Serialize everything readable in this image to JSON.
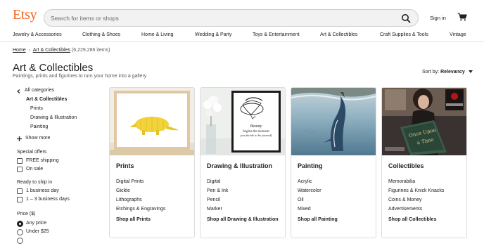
{
  "header": {
    "logo": "Etsy",
    "search_placeholder": "Search for items or shops",
    "signin": "Sign in"
  },
  "nav": [
    "Jewelry & Accessories",
    "Clothing & Shoes",
    "Home & Living",
    "Wedding & Party",
    "Toys & Entertainment",
    "Art & Collectibles",
    "Craft Supplies & Tools",
    "Vintage"
  ],
  "breadcrumb": {
    "home": "Home",
    "current": "Art & Collectibles",
    "count": "(6,229,286 items)"
  },
  "page": {
    "title": "Art & Collectibles",
    "subtitle": "Paintings, prints and figurines to turn your home into a gallery",
    "sort_label": "Sort by:",
    "sort_value": "Relevancy"
  },
  "sidebar": {
    "all_categories": "All categories",
    "current": "Art & Collectibles",
    "subcats": [
      "Prints",
      "Drawing & Illustration",
      "Painting"
    ],
    "show_more": "Show more",
    "special_offers_heading": "Special offers",
    "special_offers": [
      "FREE shipping",
      "On sale"
    ],
    "ready_heading": "Ready to ship in",
    "ready_options": [
      "1 business day",
      "1 – 3 business days"
    ],
    "price_heading": "Price ($)",
    "price_options": [
      "Any price",
      "Under $25"
    ]
  },
  "cards": [
    {
      "title": "Prints",
      "items": [
        "Digital Prints",
        "Giclée",
        "Lithographs",
        "Etchings & Engravings"
      ],
      "shop_all": "Shop all Prints"
    },
    {
      "title": "Drawing & Illustration",
      "items": [
        "Digital",
        "Pen & Ink",
        "Pencil",
        "Marker"
      ],
      "shop_all": "Shop all Drawing & Illustration",
      "art_text": [
        "Beauty",
        "begins the moment",
        "you decide to be yourself"
      ]
    },
    {
      "title": "Painting",
      "items": [
        "Acrylic",
        "Watercolor",
        "Oil",
        "Mixed"
      ],
      "shop_all": "Shop all Painting"
    },
    {
      "title": "Collectibles",
      "items": [
        "Memorabilia",
        "Figurines & Knick Knacks",
        "Coins & Money",
        "Advertisements"
      ],
      "shop_all": "Shop all Collectibles",
      "art_text": [
        "Once Upon",
        "a Time"
      ]
    }
  ],
  "icons": {
    "search": "search-icon",
    "cart": "cart-icon",
    "back": "chevron-left-icon",
    "plus": "plus-icon",
    "sort_caret": "caret-down-icon"
  },
  "colors": {
    "brand": "#f1641e"
  }
}
